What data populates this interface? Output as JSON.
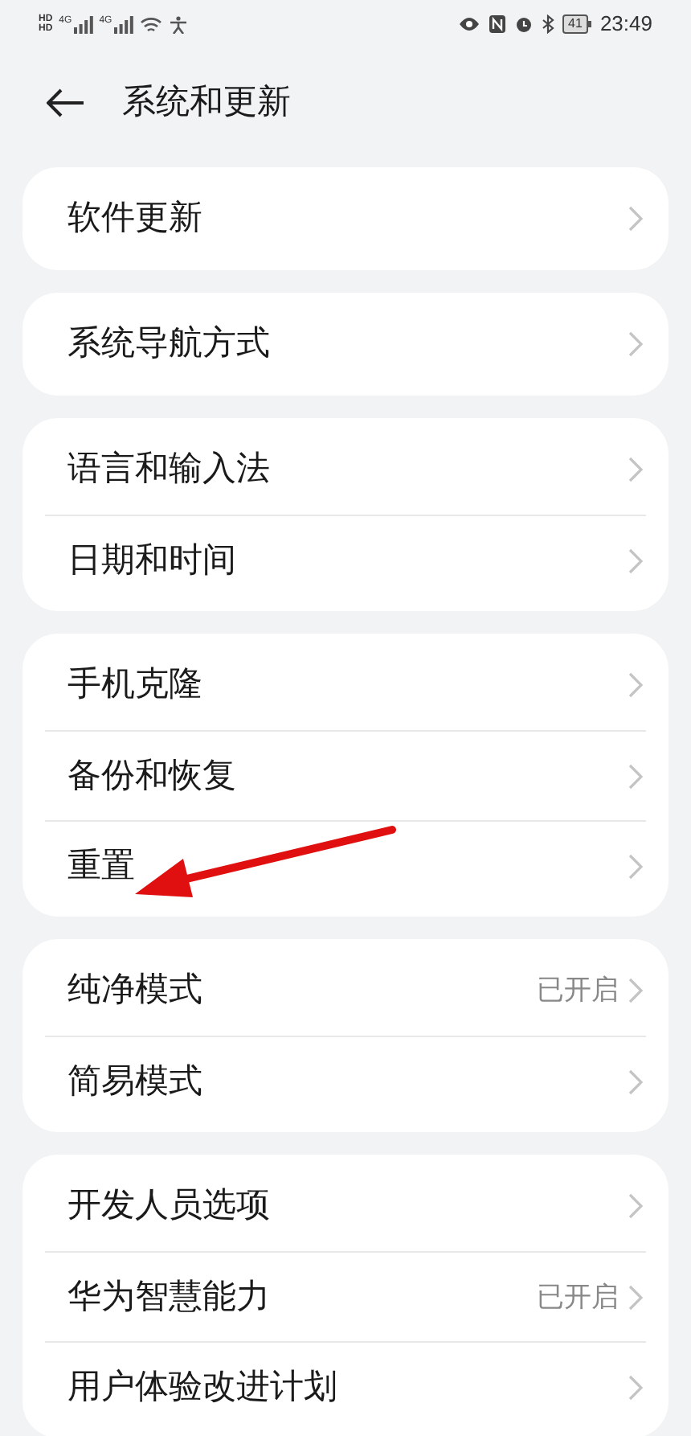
{
  "status_bar": {
    "sim_labels": [
      "HD",
      "HD"
    ],
    "network_labels": [
      "4G",
      "4G"
    ],
    "battery": "41",
    "time": "23:49"
  },
  "header": {
    "title": "系统和更新"
  },
  "groups": [
    {
      "items": [
        {
          "label": "软件更新"
        }
      ]
    },
    {
      "items": [
        {
          "label": "系统导航方式"
        }
      ]
    },
    {
      "items": [
        {
          "label": "语言和输入法"
        },
        {
          "label": "日期和时间"
        }
      ]
    },
    {
      "items": [
        {
          "label": "手机克隆"
        },
        {
          "label": "备份和恢复"
        },
        {
          "label": "重置"
        }
      ]
    },
    {
      "items": [
        {
          "label": "纯净模式",
          "value": "已开启"
        },
        {
          "label": "简易模式"
        }
      ]
    },
    {
      "items": [
        {
          "label": "开发人员选项"
        },
        {
          "label": "华为智慧能力",
          "value": "已开启"
        },
        {
          "label": "用户体验改进计划"
        }
      ]
    }
  ]
}
